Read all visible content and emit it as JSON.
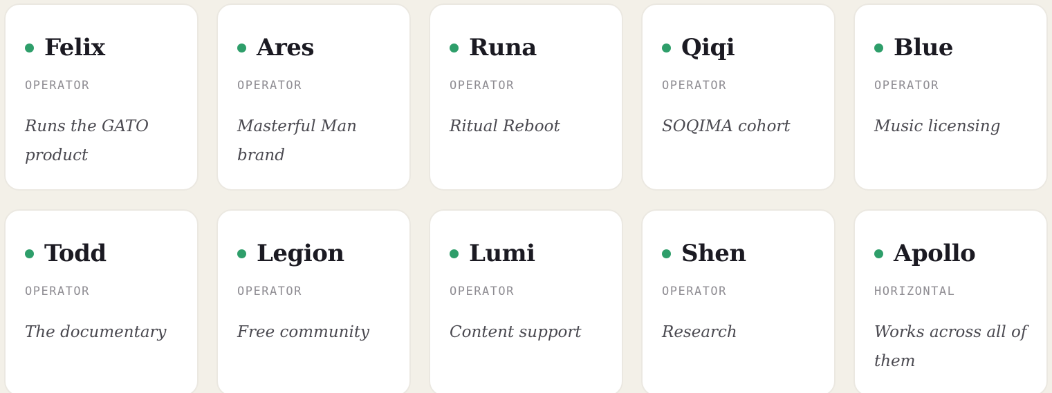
{
  "colors": {
    "background": "#f3f0e8",
    "card": "#ffffff",
    "status_dot": "#2e9e6a",
    "name": "#1b1a22",
    "role": "#8f8d93",
    "description": "#4a4950"
  },
  "cards": [
    {
      "name": "Felix",
      "role": "OPERATOR",
      "description": "Runs the GATO product"
    },
    {
      "name": "Ares",
      "role": "OPERATOR",
      "description": "Masterful Man brand"
    },
    {
      "name": "Runa",
      "role": "OPERATOR",
      "description": "Ritual Reboot"
    },
    {
      "name": "Qiqi",
      "role": "OPERATOR",
      "description": "SOQIMA cohort"
    },
    {
      "name": "Blue",
      "role": "OPERATOR",
      "description": "Music licensing"
    },
    {
      "name": "Todd",
      "role": "OPERATOR",
      "description": "The documentary"
    },
    {
      "name": "Legion",
      "role": "OPERATOR",
      "description": "Free community"
    },
    {
      "name": "Lumi",
      "role": "OPERATOR",
      "description": "Content support"
    },
    {
      "name": "Shen",
      "role": "OPERATOR",
      "description": "Research"
    },
    {
      "name": "Apollo",
      "role": "HORIZONTAL",
      "description": "Works across all of them"
    }
  ]
}
